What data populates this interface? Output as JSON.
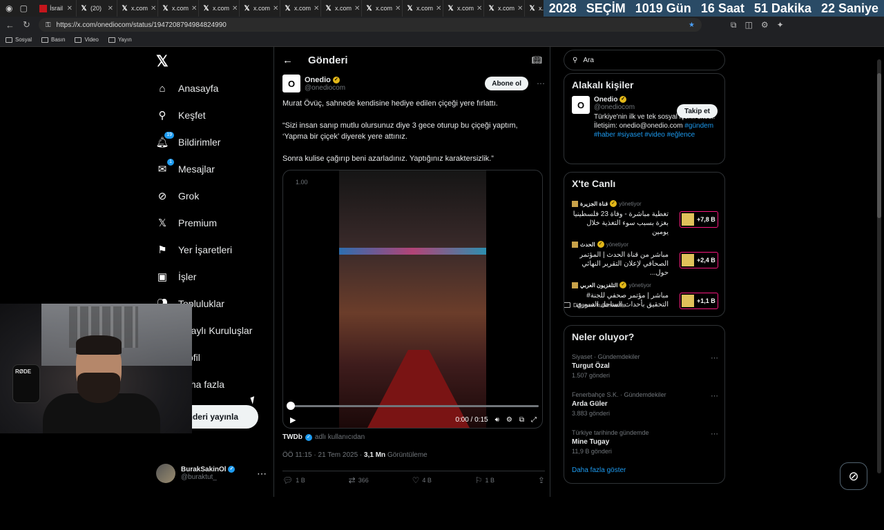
{
  "browser": {
    "tabs": [
      {
        "label": "İsrail",
        "fav": "red"
      },
      {
        "label": "(20)",
        "fav": "x"
      },
      {
        "label": "x.com",
        "fav": "x"
      },
      {
        "label": "x.com",
        "fav": "x"
      },
      {
        "label": "x.com",
        "fav": "x"
      },
      {
        "label": "x.com",
        "fav": "x"
      },
      {
        "label": "x.com",
        "fav": "x"
      },
      {
        "label": "x.com",
        "fav": "x"
      },
      {
        "label": "x.com",
        "fav": "x"
      },
      {
        "label": "x.com",
        "fav": "x"
      },
      {
        "label": "x.com",
        "fav": "x"
      },
      {
        "label": "x.com",
        "fav": "x"
      },
      {
        "label": "x.com",
        "fav": "x"
      }
    ],
    "countdown": {
      "year": "2028",
      "label": "SEÇİM",
      "days": "1019 Gün",
      "hours": "16 Saat",
      "minutes": "51 Dakika",
      "seconds": "22 Saniye"
    },
    "url": "https://x.com/onediocom/status/1947208794984824990",
    "bookmarks": [
      "Sosyal",
      "Basın",
      "Video",
      "Yayın"
    ],
    "other_bookmarks": "Diğer sık kullanılanlar"
  },
  "nav": {
    "items": [
      {
        "label": "Anasayfa",
        "icon": "home-icon",
        "glyph": "⌂"
      },
      {
        "label": "Keşfet",
        "icon": "search-icon",
        "glyph": "⚲"
      },
      {
        "label": "Bildirimler",
        "icon": "bell-icon",
        "glyph": "🔔︎",
        "badge": "19"
      },
      {
        "label": "Mesajlar",
        "icon": "mail-icon",
        "glyph": "✉",
        "badge": "1"
      },
      {
        "label": "Grok",
        "icon": "grok-icon",
        "glyph": "⊘"
      },
      {
        "label": "Premium",
        "icon": "x-premium-icon",
        "glyph": "𝕏"
      },
      {
        "label": "Yer İşaretleri",
        "icon": "bookmark-icon",
        "glyph": "⚑"
      },
      {
        "label": "İşler",
        "icon": "briefcase-icon",
        "glyph": "▣"
      },
      {
        "label": "Topluluklar",
        "icon": "communities-icon",
        "glyph": "👥︎"
      },
      {
        "label": "Onaylı Kuruluşlar",
        "icon": "verified-org-icon",
        "glyph": "⚡"
      },
      {
        "label": "Profil",
        "icon": "profile-icon",
        "glyph": "☺"
      },
      {
        "label": "Daha fazla",
        "icon": "more-icon",
        "glyph": "⋯"
      }
    ],
    "post_label": "Gönderi yayınla",
    "user": {
      "name": "BurakSakinOl",
      "handle": "@buraktut_"
    }
  },
  "post": {
    "header_title": "Gönderi",
    "author_name": "Onedio",
    "author_handle": "@onediocom",
    "subscribe_label": "Abone ol",
    "para1": "Murat Övüç, sahnede kendisine hediye edilen çiçeği yere fırlattı.",
    "para2": "“Sizi insan sanıp mutlu olursunuz diye 3 gece oturup bu çiçeği yaptım, ‘Yapma bir çiçek’ diyerek yere attınız.",
    "para3": "Sonra kulise çağırıp beni azarladınız. Yaptığınız karaktersizlik.”",
    "video": {
      "rate": "1.00",
      "time": "0:00 / 0:15",
      "progress": 0.0
    },
    "source_name": "TWDb",
    "source_suffix": "adlı kullanıcıdan",
    "timestamp": "ÖÖ 11:15 · 21 Tem 2025 · ",
    "views_value": "3,1 Mn",
    "views_label": "Görüntüleme",
    "stats": {
      "replies": "1 B",
      "reposts": "366",
      "likes": "4 B",
      "bookmarks": "1 B"
    }
  },
  "right": {
    "search_placeholder": "Ara",
    "related_title": "Alakalı kişiler",
    "related": {
      "name": "Onedio",
      "handle": "@onediocom",
      "follow_label": "Takip et",
      "bio": "Türkiye'nin ilk ve tek sosyal içerik sitesi! İletişim: onedio@onedio.com",
      "tags": "#gündem #haber #siyaset #video #eğlence"
    },
    "live_title": "X'te Canlı",
    "live": [
      {
        "channel": "قناة الجزيرة",
        "status": "yönetiyor",
        "title": "تغطية مباشرة - وفاة 23 فلسطينيا بغزة بسبب سوء التغذية خلال يومين",
        "count": "+7,8 B"
      },
      {
        "channel": "الحدث",
        "status": "yönetiyor",
        "title": "مباشر من قناة الحدث | المؤتمر الصحافي لإعلان التقرير النهائي حول...",
        "count": "+2,4 B"
      },
      {
        "channel": "التلفزيون العربي",
        "status": "yönetiyor",
        "title": "مباشر | مؤتمر صحفي للجنة# التحقيق بأحداث الساحل السوري",
        "count": "+1,1 B"
      }
    ],
    "trends_title": "Neler oluyor?",
    "trends": [
      {
        "category": "Siyaset · Gündemdekiler",
        "name": "Turgut Özal",
        "count": "1.507 gönderi"
      },
      {
        "category": "Fenerbahçe S.K. · Gündemdekiler",
        "name": "Arda Güler",
        "count": "3.883 gönderi"
      },
      {
        "category": "Türkiye tarihinde gündemde",
        "name": "Mine Tugay",
        "count": "11,9 B gönderi"
      }
    ],
    "show_more": "Daha fazla göster"
  }
}
